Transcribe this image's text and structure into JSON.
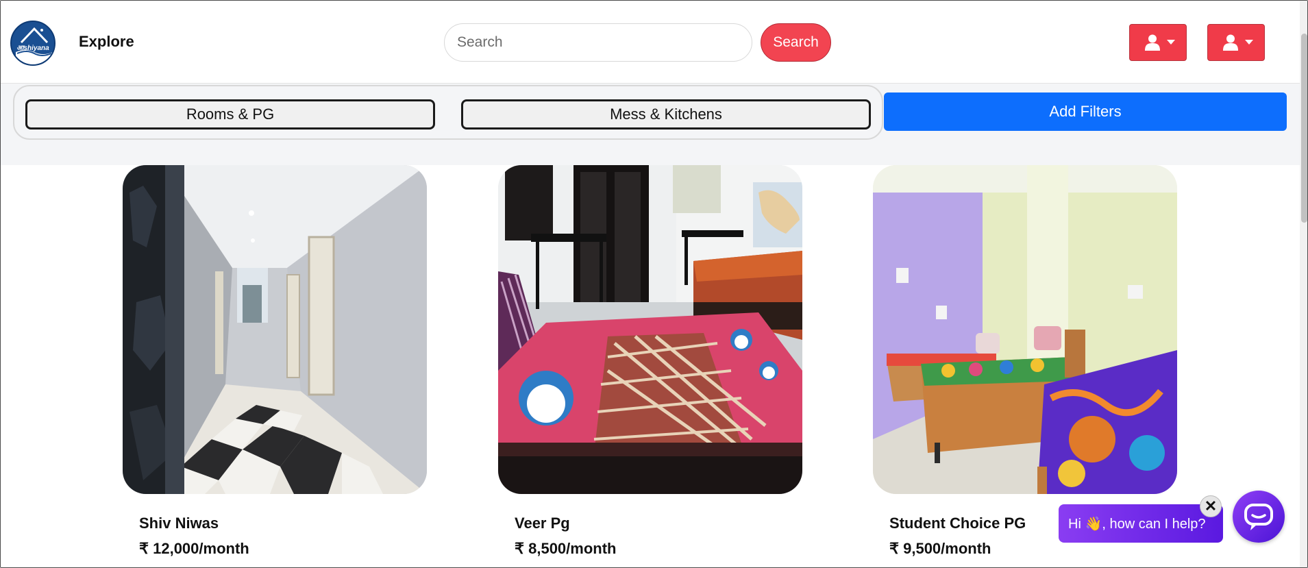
{
  "navbar": {
    "logo_text": "आshiyana",
    "explore_label": "Explore",
    "search_placeholder": "Search",
    "search_button_label": "Search",
    "user_menu_icon": "person-icon"
  },
  "filters": {
    "categories": [
      "Rooms & PG",
      "Mess & Kitchens"
    ],
    "add_filters_label": "Add Filters"
  },
  "listings": [
    {
      "name": "Shiv Niwas",
      "price": "₹ 12,000/month"
    },
    {
      "name": "Veer Pg",
      "price": "₹ 8,500/month"
    },
    {
      "name": "Student Choice PG",
      "price": "₹ 9,500/month"
    }
  ],
  "chat": {
    "greeting": "Hi 👋, how can I help?",
    "close_symbol": "✕"
  },
  "colors": {
    "search_red": "#f24451",
    "user_button_red": "#f03b49",
    "add_filters_blue": "#0d6efd",
    "chat_purple": "#6a22e6"
  }
}
